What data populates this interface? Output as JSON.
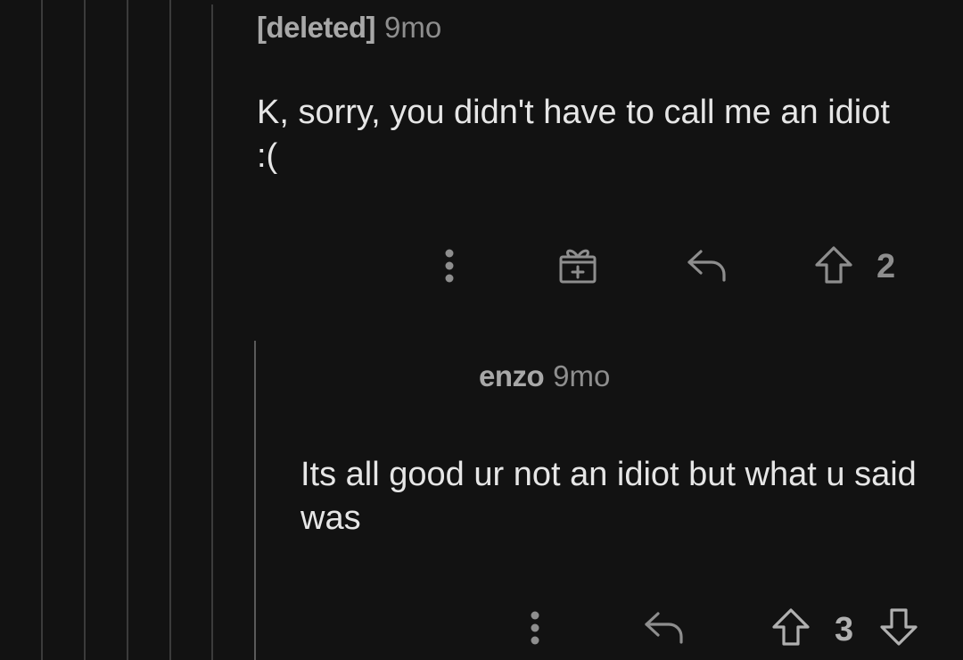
{
  "comments": [
    {
      "author": "[deleted]",
      "age": "9mo",
      "body": "K, sorry, you didn't have to call me an idiot :(",
      "score": "2",
      "actions": [
        "more-icon",
        "award-icon",
        "reply-icon",
        "upvote-icon"
      ]
    },
    {
      "author": "enzo",
      "age": "9mo",
      "body": "Its all good ur not an idiot but what u said was",
      "score": "3",
      "actions": [
        "more-icon",
        "reply-icon",
        "upvote-icon",
        "downvote-icon"
      ]
    }
  ],
  "colors": {
    "background": "#121212",
    "text": "#e6e6e6",
    "meta": "#8e8e8e",
    "thread_line": "#3b3b3b"
  }
}
